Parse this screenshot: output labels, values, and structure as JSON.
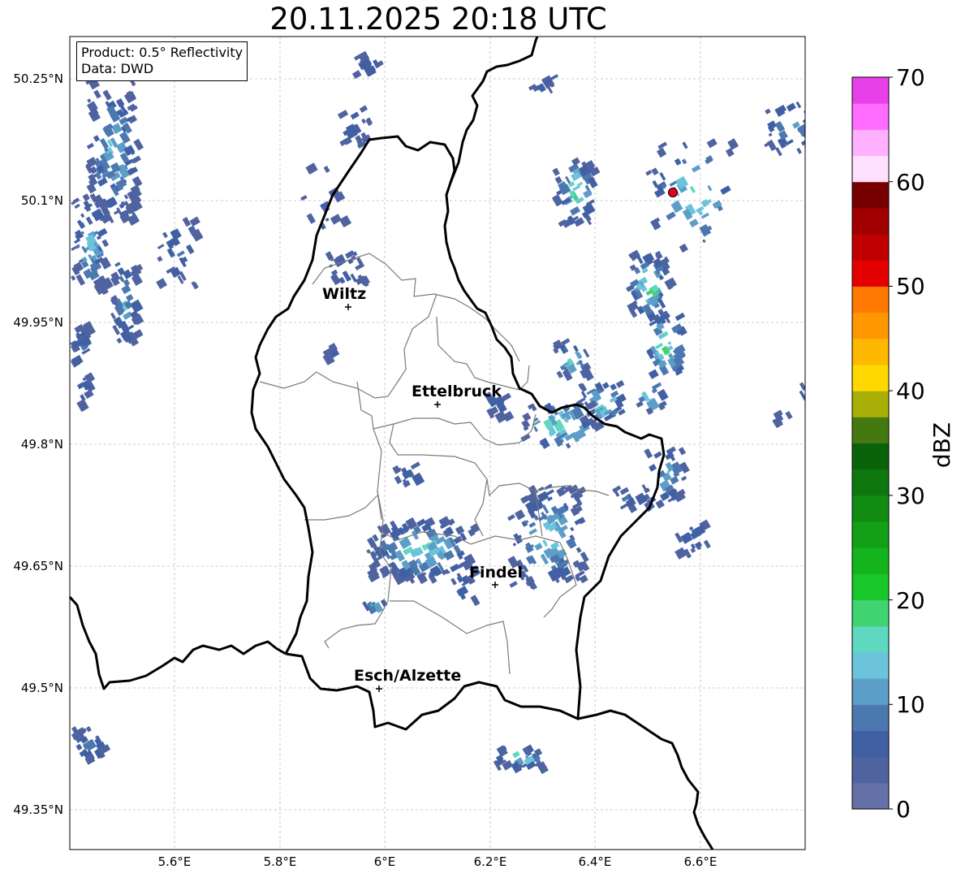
{
  "title": "20.11.2025 20:18 UTC",
  "infobox": {
    "product": "Product: 0.5° Reflectivity",
    "data_source": "Data: DWD"
  },
  "axes": {
    "lon_ticks": [
      "5.6°E",
      "5.8°E",
      "6°E",
      "6.2°E",
      "6.4°E",
      "6.6°E"
    ],
    "lat_ticks": [
      "50.25°N",
      "50.1°N",
      "49.95°N",
      "49.8°N",
      "49.65°N",
      "49.5°N",
      "49.35°N"
    ],
    "grid": true
  },
  "cities": [
    {
      "name": "Wiltz"
    },
    {
      "name": "Ettelbruck"
    },
    {
      "name": "Findel"
    },
    {
      "name": "Esch/Alzette"
    }
  ],
  "radar_site_marker": {
    "color": "#e8001c"
  },
  "colorbar": {
    "label": "dBZ",
    "ticks": [
      "0",
      "10",
      "20",
      "30",
      "40",
      "50",
      "60",
      "70"
    ],
    "min": 0,
    "max": 70,
    "step": 2.5,
    "colors": [
      "#6471a6",
      "#4e63a0",
      "#4160a4",
      "#4c78b0",
      "#5c9ec8",
      "#6cc4dc",
      "#5ed8c0",
      "#40d470",
      "#18c82a",
      "#14b41c",
      "#12a016",
      "#118c12",
      "#0e780e",
      "#0a620a",
      "#447810",
      "#a8b008",
      "#ffd800",
      "#ffb800",
      "#ff9800",
      "#ff7800",
      "#e40000",
      "#c00000",
      "#a00000",
      "#780000",
      "#ffe0ff",
      "#ffb0ff",
      "#ff6cff",
      "#e840e8"
    ]
  }
}
